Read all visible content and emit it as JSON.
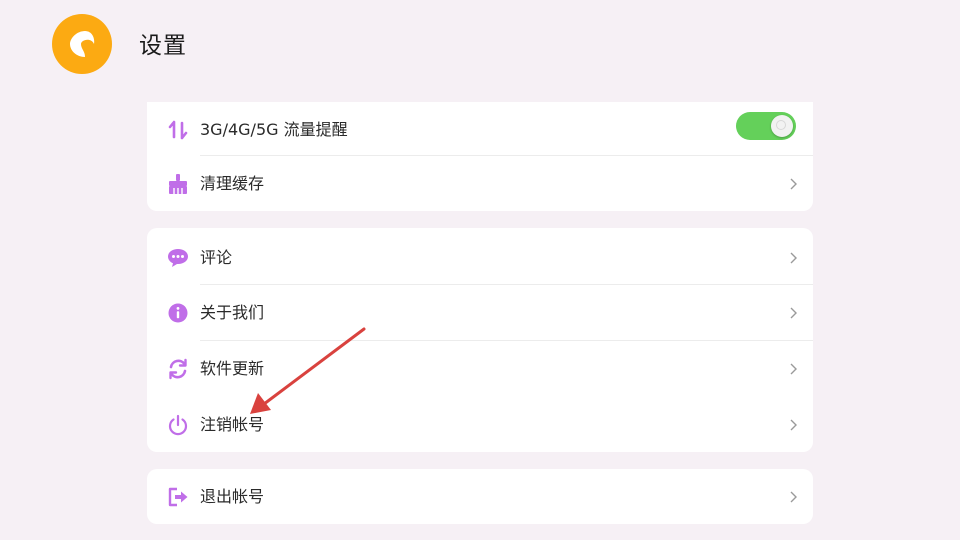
{
  "header": {
    "title": "设置",
    "logo_icon": "back-logo-icon",
    "logo_color": "#fcaa12"
  },
  "groups": [
    {
      "items": [
        {
          "label": "3G/4G/5G 流量提醒",
          "icon": "data-arrows-icon",
          "control": "toggle",
          "toggle_on": true
        },
        {
          "label": "清理缓存",
          "icon": "broom-icon",
          "control": "chevron"
        }
      ]
    },
    {
      "items": [
        {
          "label": "评论",
          "icon": "comment-bubble-icon",
          "control": "chevron"
        },
        {
          "label": "关于我们",
          "icon": "info-icon",
          "control": "chevron"
        },
        {
          "label": "软件更新",
          "icon": "refresh-icon",
          "control": "chevron"
        },
        {
          "label": "注销帐号",
          "icon": "power-icon",
          "control": "chevron"
        }
      ]
    },
    {
      "items": [
        {
          "label": "退出帐号",
          "icon": "logout-icon",
          "control": "chevron"
        }
      ]
    }
  ],
  "colors": {
    "background": "#f6f0f5",
    "accent_icon": "#c06ee8",
    "toggle_on": "#64d05a",
    "annotation_arrow": "#d9423e"
  },
  "annotation": {
    "type": "arrow",
    "target": "注销帐号"
  }
}
